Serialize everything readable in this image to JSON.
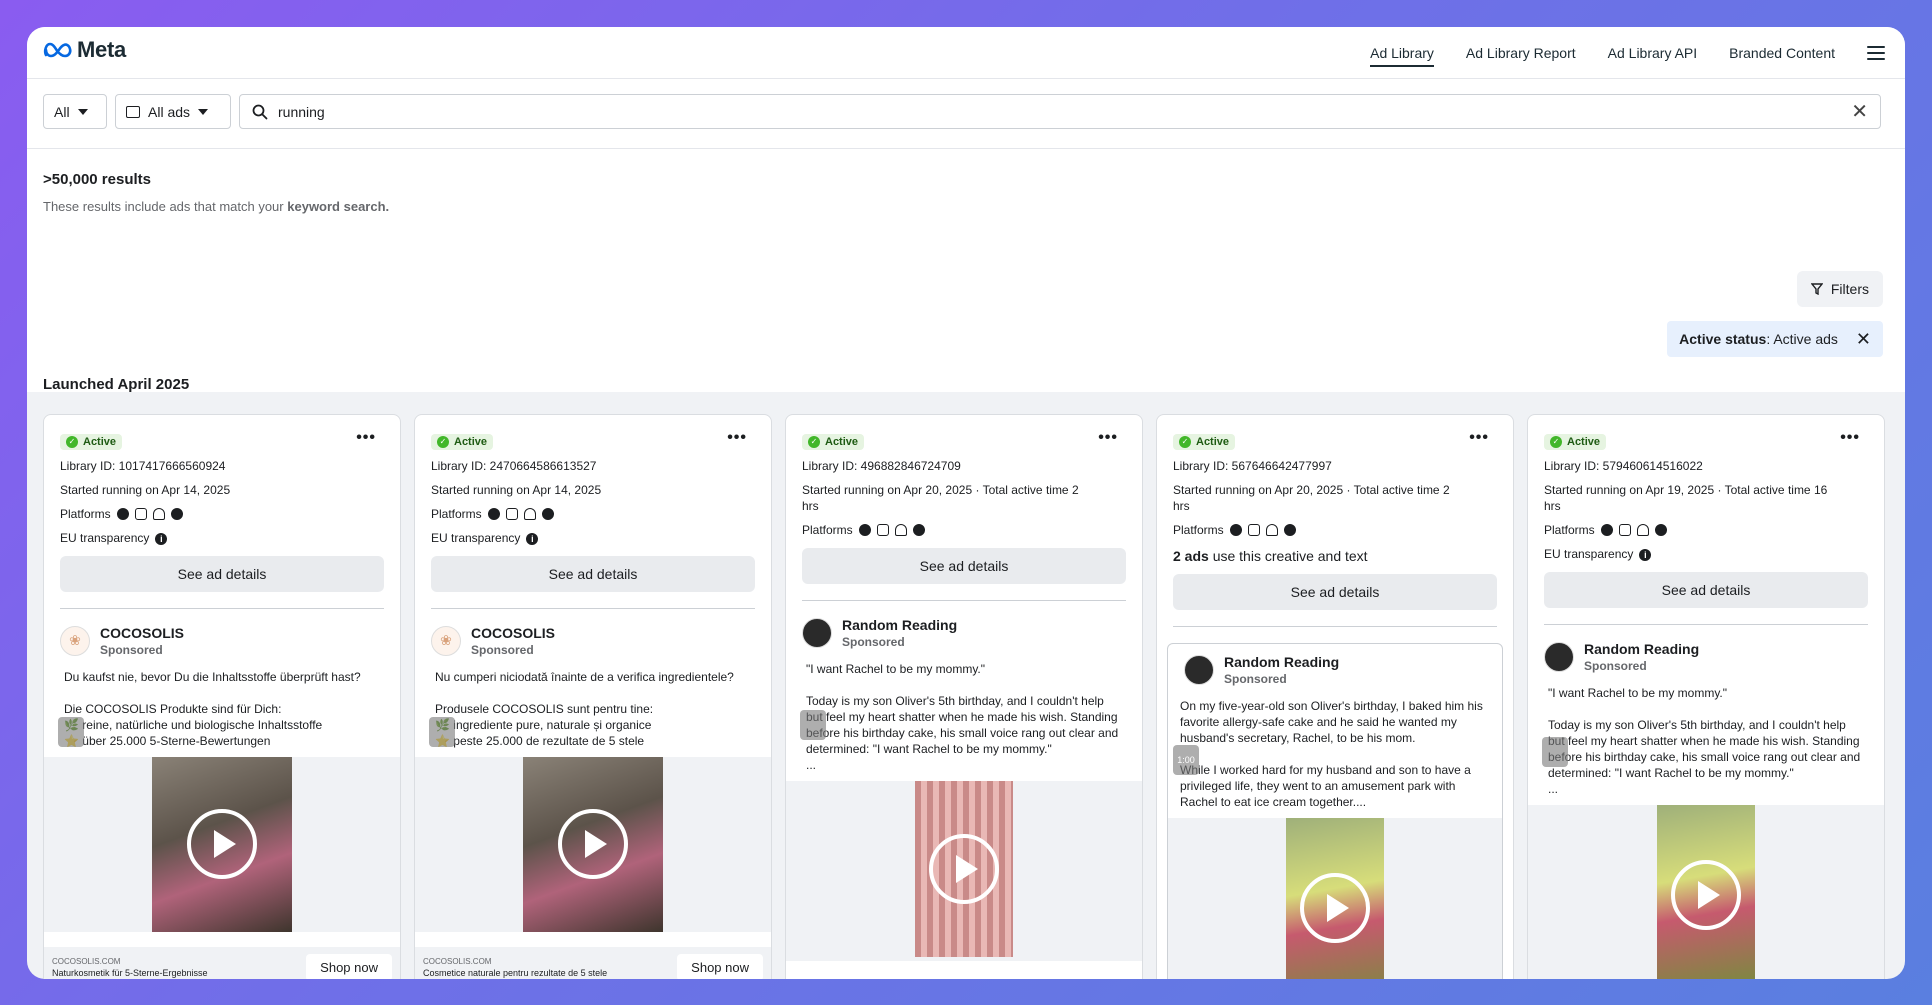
{
  "header": {
    "brand": "Meta",
    "nav": [
      "Ad Library",
      "Ad Library Report",
      "Ad Library API",
      "Branded Content"
    ]
  },
  "search": {
    "country": "All",
    "ad_type": "All ads",
    "query": "running"
  },
  "results": {
    "count": ">50,000 results",
    "sub_prefix": "These results include ads that match your",
    "sub_bold": "keyword search.",
    "filters_label": "Filters",
    "chip_key": "Active status",
    "chip_value": ": Active ads",
    "section": "Launched April 2025"
  },
  "common": {
    "active": "Active",
    "platforms": "Platforms",
    "eu": "EU transparency",
    "see_details": "See ad details",
    "sponsored": "Sponsored",
    "shop_now": "Shop now"
  },
  "cards": [
    {
      "id": "Library ID: 1017417666560924",
      "started": "Started running on Apr 14, 2025",
      "advertiser": "COCOSOLIS",
      "text": "Du kaufst nie, bevor Du die Inhaltsstoffe überprüft hast?\n\nDie COCOSOLIS Produkte sind für Dich:\n🌿 reine, natürliche und biologische Inhaltsstoffe\n⭐ über 25.000 5-Sterne-Bewertungen",
      "cta_domain": "COCOSOLIS.COM",
      "cta_desc": "Naturkosmetik für 5-Sterne-Ergebnisse"
    },
    {
      "id": "Library ID: 2470664586613527",
      "started": "Started running on Apr 14, 2025",
      "advertiser": "COCOSOLIS",
      "text": "Nu cumperi niciodată înainte de a verifica ingredientele?\n\nProdusele COCOSOLIS sunt pentru tine:\n🌿 ingrediente pure, naturale și organice\n⭐ peste 25.000 de rezultate de 5 stele",
      "cta_domain": "COCOSOLIS.COM",
      "cta_desc": "Cosmetice naturale pentru rezultate de 5 stele"
    },
    {
      "id": "Library ID: 496882846724709",
      "started": "Started running on Apr 20, 2025 · Total active time 2 hrs",
      "advertiser": "Random Reading",
      "text": "\"I want Rachel to be my mommy.\"\n\nToday is my son Oliver's 5th birthday, and I couldn't help but feel my heart shatter when he made his wish. Standing before his birthday cake, his small voice rang out clear and determined: \"I want Rachel to be my mommy.\"\n..."
    },
    {
      "id": "Library ID: 567646642477997",
      "started": "Started running on Apr 20, 2025 · Total active time 2 hrs",
      "ads_count": "2 ads",
      "ads_suffix": " use this creative and text",
      "advertiser": "Random Reading",
      "text": "On my five-year-old son Oliver's birthday, I baked him his favorite allergy-safe cake and he said he wanted my husband's secretary, Rachel, to be his mom.\n\nWhile I worked hard for my husband and son to have a privileged life, they went to an amusement park with Rachel to eat ice cream together....",
      "video_time": "1:00"
    },
    {
      "id": "Library ID: 579460614516022",
      "started": "Started running on Apr 19, 2025 · Total active time 16 hrs",
      "advertiser": "Random Reading",
      "text": "\"I want Rachel to be my mommy.\"\n\nToday is my son Oliver's 5th birthday, and I couldn't help but feel my heart shatter when he made his wish. Standing before his birthday cake, his small voice rang out clear and determined: \"I want Rachel to be my mommy.\"\n..."
    }
  ]
}
